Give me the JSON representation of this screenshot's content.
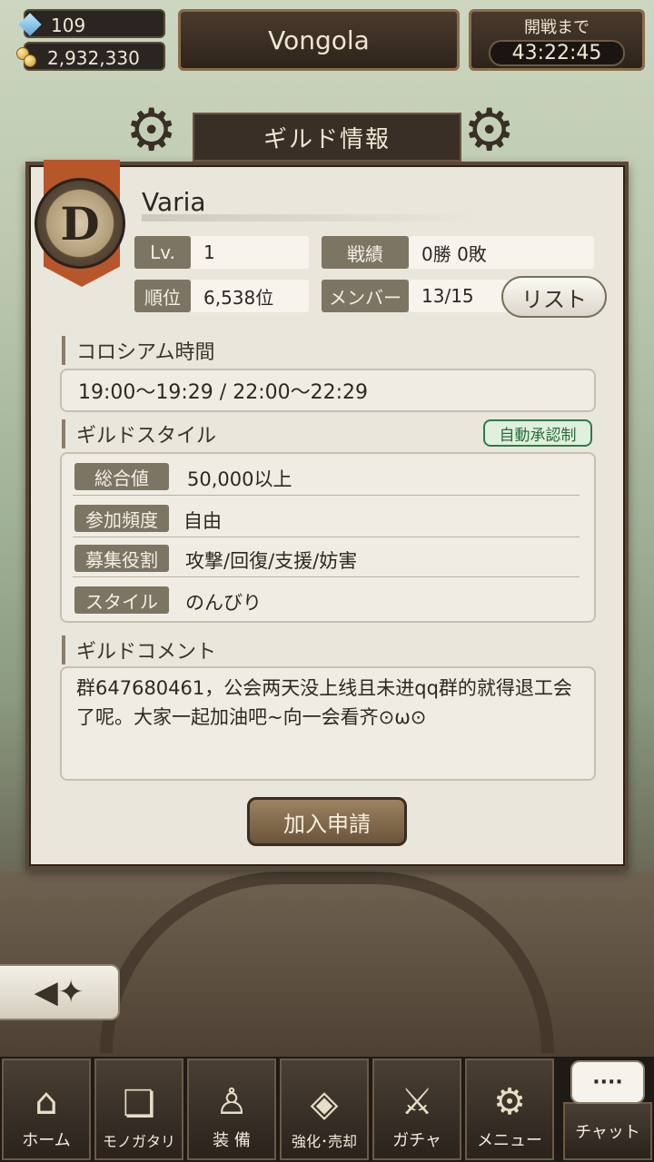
{
  "header": {
    "gems": "109",
    "coins": "2,932,330",
    "guild_button": "Vongola",
    "battle_label": "開戦まで",
    "battle_timer": "43:22:45"
  },
  "panel": {
    "title": "ギルド情報",
    "emblem_letter": "D",
    "guild_name": "Varia",
    "level_label": "Lv.",
    "level_value": "1",
    "record_label": "戦績",
    "record_value": "0勝 0敗",
    "rank_label": "順位",
    "rank_value": "6,538位",
    "members_label": "メンバー",
    "members_value": "13/15",
    "list_button": "リスト",
    "colosseum_title": "コロシアム時間",
    "colosseum_time": "19:00〜19:29 / 22:00〜22:29",
    "style_title": "ギルドスタイル",
    "auto_approve_badge": "自動承認制",
    "styles": [
      {
        "label": "総合値",
        "value": "50,000以上"
      },
      {
        "label": "参加頻度",
        "value": "自由"
      },
      {
        "label": "募集役割",
        "value": "攻撃/回復/支援/妨害"
      },
      {
        "label": "スタイル",
        "value": "のんびり"
      }
    ],
    "comment_title": "ギルドコメント",
    "comment_text": "群647680461，公会两天没上线且未进qq群的就得退工会了呢。大家一起加油吧~向一会看齐⊙ω⊙",
    "join_button": "加入申請"
  },
  "nav": {
    "items": [
      {
        "label": "ホーム",
        "icon": "home-icon"
      },
      {
        "label": "モノガタリ",
        "icon": "book-icon"
      },
      {
        "label": "装 備",
        "icon": "puppet-icon"
      },
      {
        "label": "強化･売却",
        "icon": "mask-icon"
      },
      {
        "label": "ガチャ",
        "icon": "swords-icon"
      },
      {
        "label": "メニュー",
        "icon": "gear-icon"
      },
      {
        "label": "チャット",
        "icon": "chat-icon"
      }
    ]
  },
  "chat_bubble": "····",
  "colors": {
    "panel": "#e9e6dc",
    "frame": "#5a4736",
    "badge_green": "#2f7a4a"
  }
}
